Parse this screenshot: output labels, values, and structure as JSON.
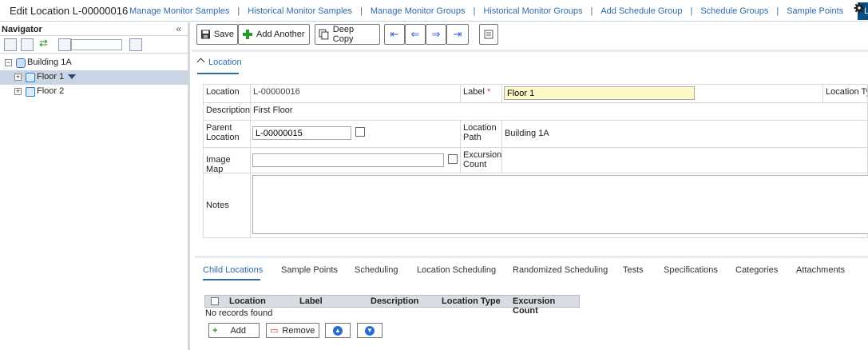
{
  "header": {
    "title": "Edit Location L-00000016",
    "nav": [
      "Manage Monitor Samples",
      "Historical Monitor Samples",
      "Manage Monitor Groups",
      "Historical Monitor Groups",
      "Add Schedule Group",
      "Schedule Groups",
      "Sample Points"
    ],
    "active": "Location"
  },
  "navigator": {
    "title": "Navigator",
    "collapse": "«",
    "search_value": "",
    "tree": [
      {
        "label": "Building 1A",
        "expander": "⊟"
      },
      {
        "label": "Floor 1",
        "expander": "⊞",
        "selected": true
      },
      {
        "label": "Floor 2",
        "expander": "⊞"
      }
    ]
  },
  "toolbar": {
    "save": "Save",
    "add_another": "Add Another",
    "deep_copy": "Deep Copy"
  },
  "section": {
    "tab": "Location"
  },
  "form": {
    "location_label": "Location",
    "location_value": "L-00000016",
    "label_label": "Label",
    "label_req": "*",
    "label_value": "Floor 1",
    "location_type_label": "Location Ty",
    "description_label": "Description",
    "description_value": "First Floor",
    "parent_label": "Parent Location",
    "parent_value": "L-00000015",
    "path_label": "Location Path",
    "path_value": "Building 1A",
    "image_map_label": "Image Map",
    "image_map_value": "",
    "excursion_label": "Excursion Count",
    "excursion_value": "",
    "notes_label": "Notes",
    "notes_value": ""
  },
  "bottom": {
    "tabs": [
      "Child Locations",
      "Sample Points",
      "Scheduling",
      "Location Scheduling",
      "Randomized Scheduling",
      "Tests",
      "Specifications",
      "Categories",
      "Attachments"
    ],
    "columns": [
      "Location",
      "Label",
      "Description",
      "Location Type",
      "Excursion Count"
    ],
    "empty": "No records found",
    "add": "Add",
    "remove": "Remove"
  },
  "colors": {
    "accent": "#2b6cb0",
    "active_tab": "#0a4f8a",
    "selected_row": "#c9d5e3",
    "required_field": "#fdf8c8"
  }
}
